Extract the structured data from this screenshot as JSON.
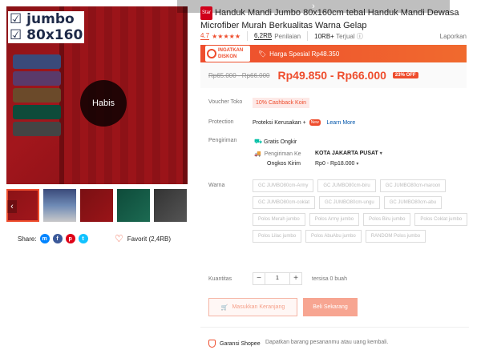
{
  "colors": {
    "accent": "#ee4d2d",
    "cashback_bg": "#fde9e7",
    "buy_disabled": "#f7a591"
  },
  "gallery": {
    "brand_line1": "jumbo",
    "brand_line2": "80x160",
    "sold_out_label": "Habis",
    "prev_arrow": "‹",
    "next_arrow": "›",
    "thumbnail_count": 5,
    "active_thumbnail": 1
  },
  "share": {
    "label": "Share:",
    "icons": [
      "messenger-icon",
      "facebook-icon",
      "pinterest-icon",
      "twitter-icon"
    ]
  },
  "favorite": {
    "label": "Favorit (2,4RB)"
  },
  "product": {
    "badge": "Star",
    "title": "Handuk Mandi Jumbo 80x160cm tebal Handuk Mandi Dewasa Microfiber Murah Berkualitas Warna Gelap",
    "rating": "4.7",
    "stars": "★★★★★",
    "ratings_count": "6,2RB",
    "ratings_label": "Penilaian",
    "sold_count": "10RB+",
    "sold_label": "Terjual",
    "report": "Laporkan"
  },
  "flash": {
    "badge_line1": "INGATKAN",
    "badge_line2": "DISKON",
    "text": "Harga Spesial Rp48.350"
  },
  "price": {
    "old": "Rp65.000 - Rp66.000",
    "current": "Rp49.850 - Rp66.000",
    "discount": "23% OFF"
  },
  "voucher": {
    "label": "Voucher Toko",
    "value": "10% Cashback Koin"
  },
  "protection": {
    "label": "Protection",
    "value": "Proteksi Kerusakan +",
    "new_badge": "New",
    "link": "Learn More"
  },
  "shipping": {
    "label": "Pengiriman",
    "free": "Gratis Ongkir",
    "to_label": "Pengiriman Ke",
    "to_value": "KOTA JAKARTA PUSAT",
    "cost_label": "Ongkos Kirim",
    "cost_value": "Rp0 - Rp18.000"
  },
  "variants": {
    "label": "Warna",
    "options": [
      "GC JUMBO80cm-Army",
      "GC JUMBO80cm-biru",
      "GC JUMBO80cm-maroon",
      "GC JUMBO80cm-coklat",
      "GC JUMBO80cm-ungu",
      "GC JUMBO80cm-abu",
      "Polos Merah jumbo",
      "Polos Army jumbo",
      "Polos Biru jumbo",
      "Polos Coklat jumbo",
      "Polos Lilac jumbo",
      "Polos AbuAbu jumbo",
      "RANDOM Polos jumbo"
    ]
  },
  "quantity": {
    "label": "Kuantitas",
    "value": "1",
    "minus": "−",
    "plus": "+",
    "stock": "tersisa 0 buah"
  },
  "actions": {
    "cart": "Masukkan Keranjang",
    "buy": "Beli Sekarang"
  },
  "guarantee": {
    "label": "Garansi Shopee",
    "desc": "Dapatkan barang pesananmu atau uang kembali."
  }
}
